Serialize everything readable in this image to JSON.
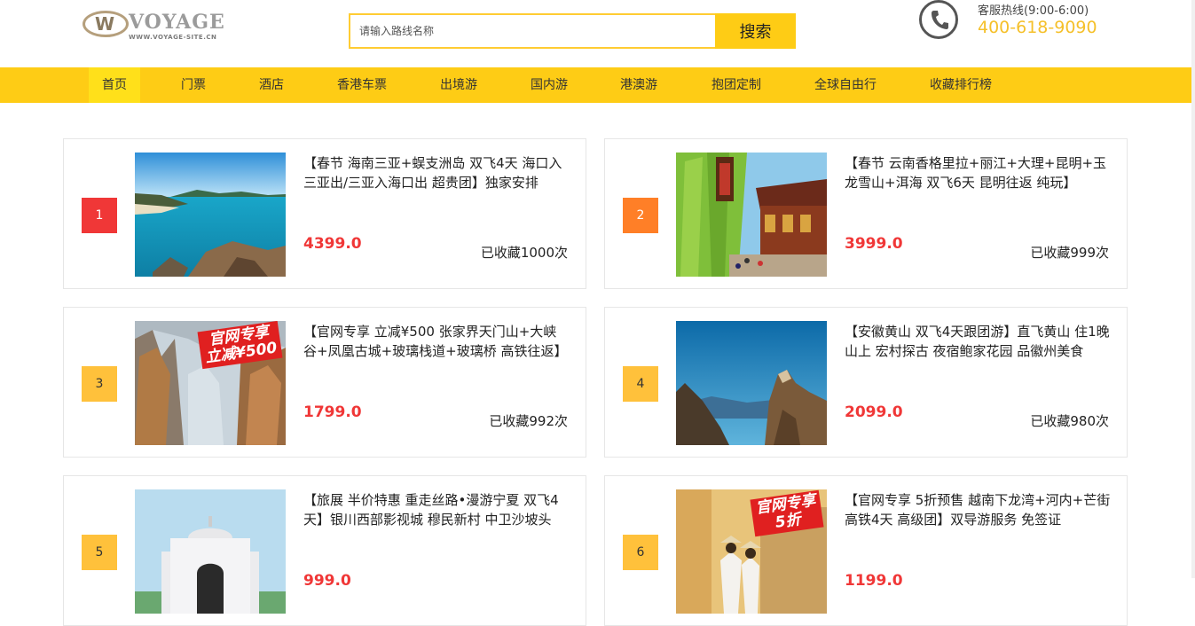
{
  "header": {
    "logo": {
      "word": "VOYAGE",
      "site": "WWW.VOYAGE-SITE.CN"
    },
    "search": {
      "placeholder": "请输入路线名称",
      "button_label": "搜索"
    },
    "hotline": {
      "label": "客服热线(9:00-6:00)",
      "number": "400-618-9090"
    }
  },
  "nav": {
    "items": [
      "首页",
      "门票",
      "酒店",
      "香港车票",
      "出境游",
      "国内游",
      "港澳游",
      "抱团定制",
      "全球自由行",
      "收藏排行榜"
    ],
    "active_index": 0
  },
  "colors": {
    "accent": "#fecc15",
    "price": "#f03737",
    "rank_1": "#f03737",
    "rank_2": "#ff7f27",
    "rank_other": "#ffc13b"
  },
  "cards": [
    {
      "rank": "1",
      "title": "【春节 海南三亚+蜈支洲岛 双飞4天 海口入三亚出/三亚入海口出 超贵团】独家安排",
      "price": "4399.0",
      "fav": "已收藏1000次",
      "image": "beach-coast",
      "badge_lines": []
    },
    {
      "rank": "2",
      "title": "【春节 云南香格里拉+丽江+大理+昆明+玉龙雪山+洱海 双飞6天 昆明往返 纯玩】",
      "price": "3999.0",
      "fav": "已收藏999次",
      "image": "old-town-willows",
      "badge_lines": []
    },
    {
      "rank": "3",
      "title": "【官网专享 立减¥500 张家界天门山+大峡谷+凤凰古城+玻璃栈道+玻璃桥 高铁往返】",
      "price": "1799.0",
      "fav": "已收藏992次",
      "image": "snowy-peaks",
      "badge_lines": [
        "官网专享",
        "立减¥500"
      ]
    },
    {
      "rank": "4",
      "title": "【安徽黄山 双飞4天跟团游】直飞黄山 住1晚山上 宏村探古 夜宿鲍家花园 品徽州美食",
      "price": "2099.0",
      "fav": "已收藏980次",
      "image": "mountain-sky",
      "badge_lines": []
    },
    {
      "rank": "5",
      "title": "【旅展 半价特惠 重走丝路•漫游宁夏 双飞4天】银川西部影视城 穆民新村 中卫沙坡头",
      "price": "999.0",
      "fav": "",
      "image": "white-mosque",
      "badge_lines": []
    },
    {
      "rank": "6",
      "title": "【官网专享 5折预售 越南下龙湾+河内+芒街 高铁4天 高级团】双导游服务 免签证",
      "price": "1199.0",
      "fav": "",
      "image": "yellow-wall",
      "badge_lines": [
        "官网专享",
        "5折"
      ]
    }
  ]
}
